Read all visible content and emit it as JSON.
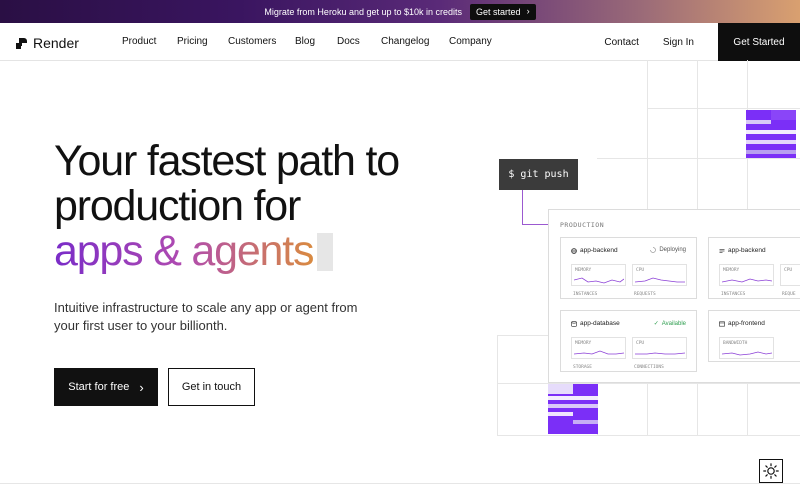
{
  "announcement": {
    "text": "Migrate from Heroku and get up to $10k in credits",
    "button_label": "Get started"
  },
  "nav": {
    "brand": "Render",
    "links": [
      "Product",
      "Pricing",
      "Customers",
      "Blog",
      "Docs",
      "Changelog",
      "Company"
    ],
    "contact": "Contact",
    "sign_in": "Sign In",
    "cta": "Get Started"
  },
  "hero": {
    "title_line1": "Your fastest path to",
    "title_line2": "production for",
    "title_line3": "apps & agents",
    "subtitle": "Intuitive infrastructure to scale any app or agent from your first user to your billionth.",
    "primary_button": "Start for free",
    "secondary_button": "Get in touch"
  },
  "illustration": {
    "command": "$ git push",
    "panel_label": "PRODUCTION",
    "services": [
      {
        "name": "app-backend",
        "status": "Deploying",
        "metrics": [
          "MEMORY",
          "CPU"
        ],
        "footers": [
          "INSTANCES",
          "REQUESTS"
        ]
      },
      {
        "name": "app-backend",
        "status": "",
        "metrics": [
          "MEMORY",
          "CPU"
        ],
        "footers": [
          "INSTANCES",
          "REQUE"
        ]
      },
      {
        "name": "app-database",
        "status": "Available",
        "metrics": [
          "MEMORY",
          "CPU"
        ],
        "footers": [
          "STORAGE",
          "CONNECTIONS"
        ]
      },
      {
        "name": "app-frontend",
        "status": "",
        "metrics": [
          "BANDWIDTH"
        ],
        "footers": []
      }
    ]
  },
  "colors": {
    "accent_purple": "#7b2ff7",
    "available_green": "#2e9e4f",
    "dark": "#111111"
  },
  "icons": {
    "announce_chevron": "chevron-right-icon",
    "primary_chevron": "chevron-right-icon",
    "theme_toggle": "sun-icon"
  }
}
